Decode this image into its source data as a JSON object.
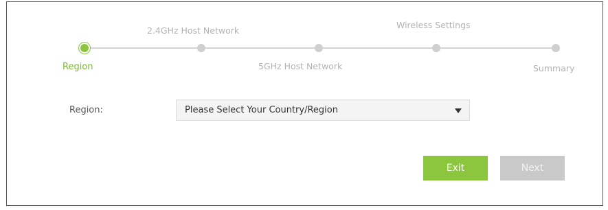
{
  "steps": [
    {
      "label": "Region",
      "state": "active"
    },
    {
      "label": "2.4GHz Host Network",
      "state": "inactive"
    },
    {
      "label": "5GHz Host Network",
      "state": "inactive"
    },
    {
      "label": "Wireless Settings",
      "state": "inactive"
    },
    {
      "label": "Summary",
      "state": "inactive"
    }
  ],
  "form": {
    "region_label": "Region:",
    "region_select_value": "Please Select Your Country/Region"
  },
  "buttons": {
    "exit": "Exit",
    "next": "Next"
  },
  "colors": {
    "accent_green": "#8cc63f",
    "inactive_gray": "#cfcfcf",
    "disabled_button": "#c9c9c9"
  }
}
